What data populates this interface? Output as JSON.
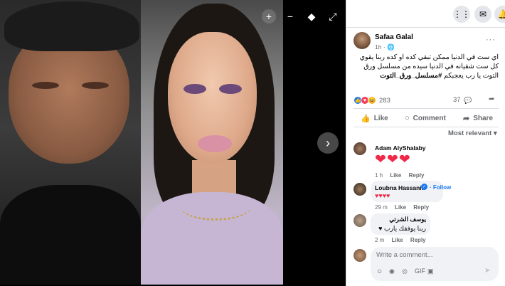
{
  "viewer": {
    "zoom_in_icon": "+",
    "zoom_out_icon": "−",
    "tag_icon": "◆",
    "fullscreen_icon": "⤢",
    "next_icon": "›"
  },
  "top_bar": {
    "menu_icon": "⋮⋮",
    "messenger_icon": "✉",
    "notifications_icon": "🔔"
  },
  "post": {
    "author": "Safaa Galal",
    "time": "1h · ",
    "more": "···",
    "text": "اي ست في الدنيا ممكن تبقي كده او كده ربنا يقوي كل ست شقيانه في الدنيا سيده من مسلسل ورق التوت يا رب يعجبكم ",
    "hashtag": "#مسلسل_ورق_التوت"
  },
  "stats": {
    "reactions_count": "283",
    "comments_count": "37",
    "like_reaction": "👍",
    "love_reaction": "♥",
    "haha_reaction": "😆",
    "comment_icon": "💬",
    "share_icon": "➦"
  },
  "actions": {
    "like": "Like",
    "comment": "Comment",
    "share": "Share",
    "like_icon": "👍",
    "comment_icon": "○",
    "share_icon": "➦"
  },
  "comments_filter": "Most relevant ▾",
  "comments": [
    {
      "name": "Adam AlyShalaby",
      "text": "❤❤❤",
      "time": "1 h",
      "like": "Like",
      "reply": "Reply"
    },
    {
      "name": "Loubna Hassanin",
      "verified": "✓",
      "follow": "· Follow",
      "text": "♥♥♥♥",
      "time": "29 m",
      "like": "Like",
      "reply": "Reply"
    },
    {
      "name": "يوسف الشرتي",
      "text": "ربنا يوفقك يارب ♥",
      "time": "2 m",
      "like": "Like",
      "reply": "Reply"
    }
  ],
  "composer": {
    "placeholder": "Write a comment...",
    "icons": [
      "☺",
      "◉",
      "◎",
      "GIF",
      "▣"
    ],
    "send_icon": "➤"
  }
}
